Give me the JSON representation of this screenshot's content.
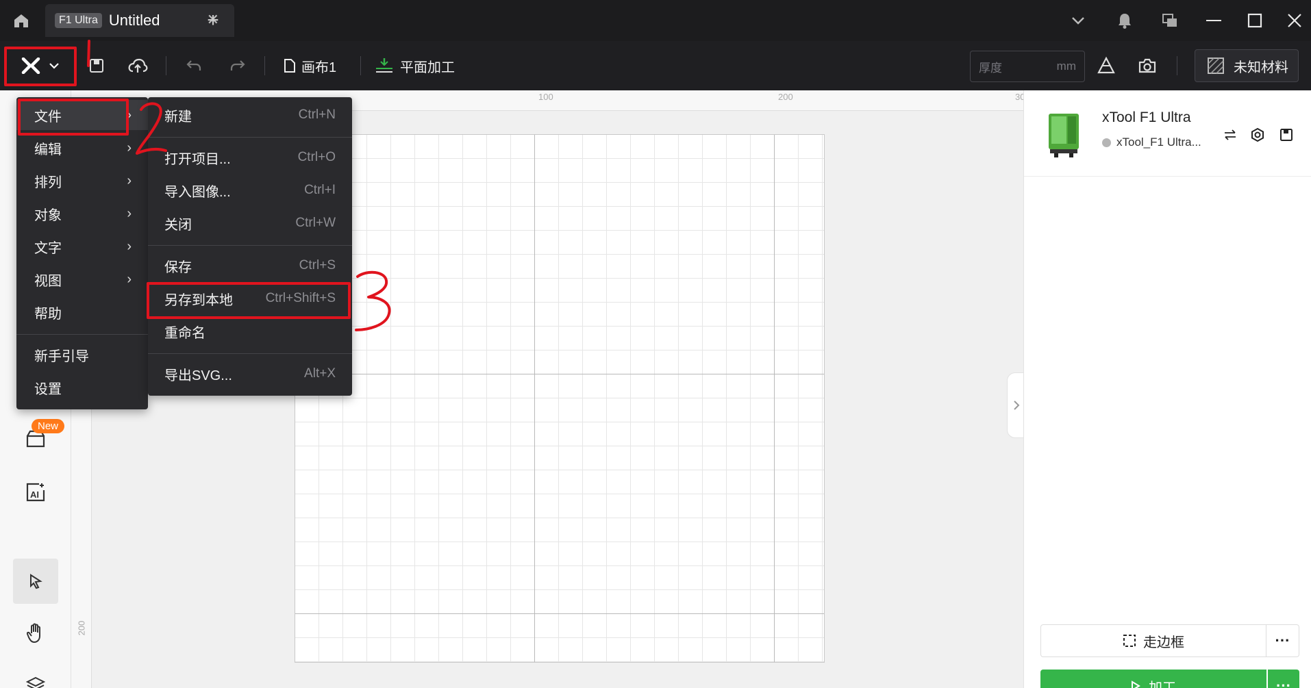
{
  "titlebar": {
    "tab_badge": "F1 Ultra",
    "tab_title": "Untitled",
    "tab_close": "✕",
    "new_tab": "+"
  },
  "toolbar": {
    "canvas_label": "画布1",
    "mode_label": "平面加工",
    "thickness_placeholder": "厚度",
    "thickness_unit": "mm",
    "material_label": "未知材料"
  },
  "ruler": {
    "h_labels": [
      "100",
      "200",
      "30"
    ],
    "v_labels": [
      "200"
    ]
  },
  "sidebar": {
    "new_badge": "New"
  },
  "main_menu": {
    "items": [
      {
        "label": "文件",
        "has_sub": true
      },
      {
        "label": "编辑",
        "has_sub": true
      },
      {
        "label": "排列",
        "has_sub": true
      },
      {
        "label": "对象",
        "has_sub": true
      },
      {
        "label": "文字",
        "has_sub": true
      },
      {
        "label": "视图",
        "has_sub": true
      },
      {
        "label": "帮助",
        "has_sub": false
      },
      {
        "label": "新手引导",
        "has_sub": false
      },
      {
        "label": "设置",
        "has_sub": false
      }
    ]
  },
  "file_menu": {
    "items": [
      {
        "label": "新建",
        "shortcut": "Ctrl+N"
      },
      {
        "label": "打开项目...",
        "shortcut": "Ctrl+O"
      },
      {
        "label": "导入图像...",
        "shortcut": "Ctrl+I"
      },
      {
        "label": "关闭",
        "shortcut": "Ctrl+W"
      },
      {
        "label": "保存",
        "shortcut": "Ctrl+S"
      },
      {
        "label": "另存到本地",
        "shortcut": "Ctrl+Shift+S"
      },
      {
        "label": "重命名",
        "shortcut": ""
      },
      {
        "label": "导出SVG...",
        "shortcut": "Alt+X"
      }
    ]
  },
  "device": {
    "name": "xTool F1 Ultra",
    "connection": "xTool_F1 Ultra..."
  },
  "actions": {
    "frame_label": "走边框",
    "process_label": "加工",
    "more": "···"
  },
  "annotations": [
    "1",
    "2",
    "3"
  ],
  "colors": {
    "accent_green": "#35b54a",
    "annotation_red": "#e0141e",
    "menu_bg": "#2a2a2d",
    "toolbar_bg": "#1f1f22",
    "new_badge": "#ff7a1a"
  }
}
